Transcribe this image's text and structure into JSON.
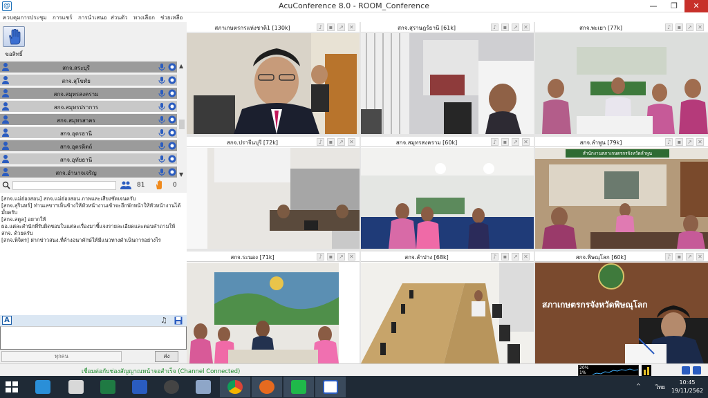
{
  "window": {
    "title": "AcuConference 8.0 - ROOM_Conference",
    "minimize": "—",
    "maximize": "❐",
    "close": "✕"
  },
  "menu": [
    "ควบคุมการประชุม",
    "การแชร์",
    "การนำเสนอ",
    "ส่วนตัว",
    "ทางเลือก",
    "ช่วยเหลือ"
  ],
  "sidebar": {
    "raise_hand_label": "ขอสิทธิ์",
    "sites": [
      {
        "name": "สกจ.สระบุรี",
        "shade": "dark"
      },
      {
        "name": "สกจ.สุโขทัย",
        "shade": "light"
      },
      {
        "name": "สกจ.สมุทรสงคราม",
        "shade": "dark"
      },
      {
        "name": "สกจ.สมุทรปราการ",
        "shade": "light"
      },
      {
        "name": "สกจ.สมุทรสาคร",
        "shade": "dark"
      },
      {
        "name": "สกจ.อุดรธานี",
        "shade": "light"
      },
      {
        "name": "สกจ.อุตรดิตถ์",
        "shade": "dark"
      },
      {
        "name": "สกจ.อุทัยธานี",
        "shade": "light"
      },
      {
        "name": "สกจ.อำนาจเจริญ",
        "shade": "dark"
      }
    ],
    "search_placeholder": "",
    "participant_count": "81",
    "hand_count": "0"
  },
  "chat": {
    "messages": [
      "[สกจ.แม่ฮ่องสอน] สกจ.แม่ฮ่องสอน ภาพและเสียงชัดเจนครับ",
      "[สกจ.สุรินทร์] ท่านเลขาฯเห็นข้างให้หัวหน้างานเข้าจะอีกพักหน้าให้หัวหน้างานได้มั้ยครับ",
      "[สกจ.สตูล] อยากให้",
      "ผอ.แต่ละสำนักที่รับผิดชอบในแต่ละเรื่องมาชี้แจงรายละเอียดและตอบคำถามให้ สกจ. ด้วยครับ",
      "[สกจ.พิจิตร] ฝากข่าวสนง.ที่ค้างอนาคักษ์ให้มีแนวทางดำเนินการอย่างไร"
    ],
    "send_field": "ทุกคน",
    "send_button": "ส่ง"
  },
  "tiles": [
    {
      "label": "สภาเกษตรกรแห่งชาติ1 [130k]",
      "scene": "speaker"
    },
    {
      "label": "สกจ.สุราษฎร์ธานี [61k]",
      "scene": "office"
    },
    {
      "label": "สกจ.พะเยา [77k]",
      "scene": "group"
    },
    {
      "label": "สกจ.ปราจีนบุรี [72k]",
      "scene": "room"
    },
    {
      "label": "สกจ.สมุทรสงคราม [60k]",
      "scene": "meeting"
    },
    {
      "label": "สกจ.ลำพูน [79k]",
      "scene": "hall"
    },
    {
      "label": "สกจ.ระนอง [71k]",
      "scene": "banner"
    },
    {
      "label": "สกจ.ลำปาง [68k]",
      "scene": "boardroom"
    },
    {
      "label": "สกจ.พิษณุโลก [60k]",
      "scene": "sign"
    }
  ],
  "tile_signage": {
    "hall_sign": "สำนักงานสภาเกษตรกรจังหวัดลำพูน",
    "sign_text": "สภาเกษตรกรจังหวัดพิษณุโลก"
  },
  "status": {
    "connection": "เชื่อมต่อกับช่องสัญญาณหน้าจอสำเร็จ (Channel Connected)",
    "meter_top": "20%",
    "meter_bottom": "1%"
  },
  "taskbar": {
    "time": "10:45",
    "date": "19/11/2562",
    "lang": "ไทย",
    "tray_arrow": "^"
  },
  "colors": {
    "status_green": "#1d8a2b",
    "close_red": "#c7302a",
    "taskbar": "#1f2a36"
  }
}
